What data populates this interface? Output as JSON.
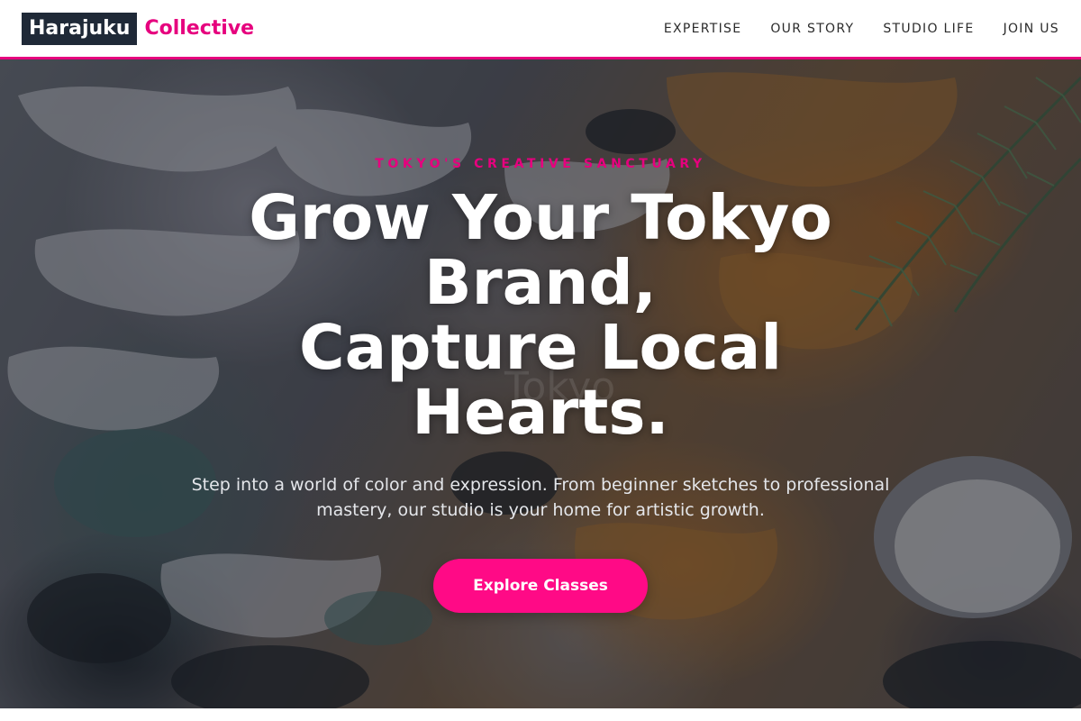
{
  "brand": {
    "name_part1": "Harajuku",
    "name_part2": "Collective",
    "dark_color": "#1f2937",
    "accent_color": "#e6007e"
  },
  "nav": {
    "items": [
      {
        "label": "EXPERTISE"
      },
      {
        "label": "OUR STORY"
      },
      {
        "label": "STUDIO LIFE"
      },
      {
        "label": "JOIN US"
      }
    ]
  },
  "hero": {
    "eyebrow": "TOKYO'S CREATIVE SANCTUARY",
    "headline_lines": [
      "Grow Your Tokyo",
      "Brand,",
      "Capture Local",
      "Hearts."
    ],
    "watermark": "Tokyo",
    "subtext": "Step into a world of color and expression. From beginner sketches to professional mastery, our studio is your home for artistic growth.",
    "cta_label": "Explore Classes",
    "cta_color": "#ff0a86",
    "background_image": "abstract-oil-paint-palette-with-rosemary"
  }
}
